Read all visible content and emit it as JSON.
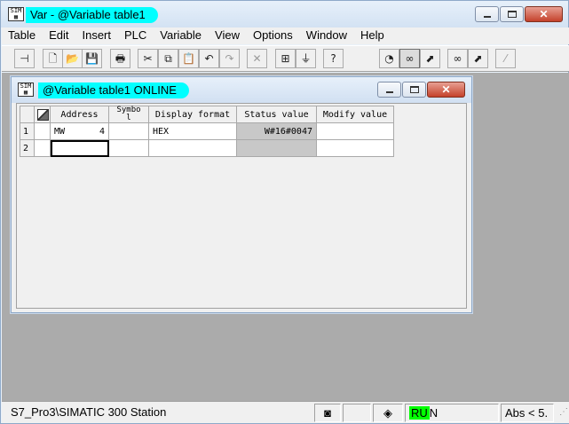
{
  "app": {
    "title": "Var - @Variable table1",
    "icon_text": "SIM",
    "icon": "simatic-var-icon"
  },
  "caption_buttons": {
    "minimize": "minimize-icon",
    "maximize": "maximize-icon",
    "close": "✕"
  },
  "menu": [
    "Table",
    "Edit",
    "Insert",
    "PLC",
    "Variable",
    "View",
    "Options",
    "Window",
    "Help"
  ],
  "toolbar": [
    {
      "name": "pin-icon",
      "glyph": "⊣"
    },
    {
      "name": "new-icon",
      "glyph": "🗋"
    },
    {
      "name": "open-icon",
      "glyph": "📂"
    },
    {
      "name": "save-icon",
      "glyph": "💾"
    },
    {
      "name": "print-icon",
      "glyph": "🖶"
    },
    {
      "name": "cut-icon",
      "glyph": "✂"
    },
    {
      "name": "copy-icon",
      "glyph": "⧉"
    },
    {
      "name": "paste-icon",
      "glyph": "📋"
    },
    {
      "name": "undo-icon",
      "glyph": "↶"
    },
    {
      "name": "redo-icon",
      "glyph": "↷"
    },
    {
      "name": "delete-icon",
      "glyph": "✕"
    },
    {
      "name": "network-icon",
      "glyph": "⊞"
    },
    {
      "name": "online-icon",
      "glyph": "⏚"
    },
    {
      "name": "help-pointer-icon",
      "glyph": "?"
    },
    {
      "name": "monitor-once-icon",
      "glyph": "◔"
    },
    {
      "name": "monitor-icon",
      "glyph": "∞"
    },
    {
      "name": "modify-once-icon",
      "glyph": "⬈"
    },
    {
      "name": "monitor-trigger-icon",
      "glyph": "∞"
    },
    {
      "name": "modify-trigger-icon",
      "glyph": "⬈"
    },
    {
      "name": "force-icon",
      "glyph": "⁄"
    }
  ],
  "child": {
    "title": "@Variable table1  ONLINE",
    "icon_text": "SIM"
  },
  "table": {
    "headers": [
      "Address",
      "Symbo l",
      "Display format",
      "Status value",
      "Modify value"
    ],
    "rows": [
      {
        "num": "1",
        "address_area": "MW",
        "address_num": "4",
        "symbol": "",
        "format": "HEX",
        "status": "W#16#0047",
        "modify": ""
      },
      {
        "num": "2",
        "address_area": "",
        "address_num": "",
        "symbol": "",
        "format": "",
        "status": "",
        "modify": ""
      }
    ]
  },
  "statusbar": {
    "path": "S7_Pro3\\SIMATIC 300 Station",
    "mode_ru": "RU",
    "mode_n": "N",
    "abs": "Abs < 5."
  },
  "colors": {
    "title_highlight": "#00ffff",
    "run_indicator": "#00ff00",
    "mdi_background": "#ababab"
  }
}
